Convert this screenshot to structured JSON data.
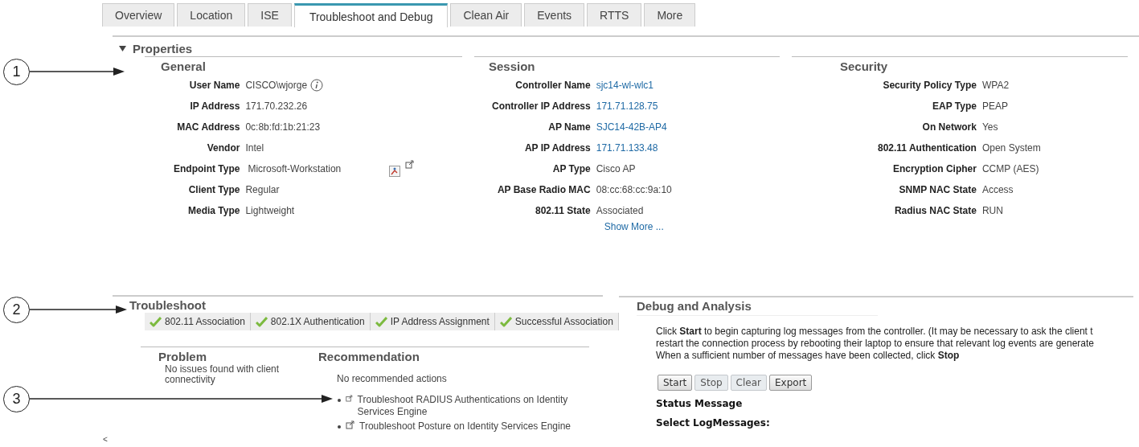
{
  "tabs": [
    {
      "label": "Overview",
      "selected": false
    },
    {
      "label": "Location",
      "selected": false
    },
    {
      "label": "ISE",
      "selected": false
    },
    {
      "label": "Troubleshoot and Debug",
      "selected": true
    },
    {
      "label": "Clean Air",
      "selected": false
    },
    {
      "label": "Events",
      "selected": false
    },
    {
      "label": "RTTS",
      "selected": false
    },
    {
      "label": "More",
      "selected": false
    }
  ],
  "properties": {
    "title": "Properties",
    "expanded": true,
    "groups": [
      {
        "title": "General",
        "fields": [
          {
            "label": "User Name",
            "value": "CISCO\\wjorge",
            "kind": "info"
          },
          {
            "label": "IP Address",
            "value": "171.70.232.26",
            "kind": "text"
          },
          {
            "label": "MAC Address",
            "value": "0c:8b:fd:1b:21:23",
            "kind": "text"
          },
          {
            "label": "Vendor",
            "value": "Intel",
            "kind": "text"
          },
          {
            "label": "Endpoint Type",
            "value": "Microsoft-Workstation",
            "kind": "tools"
          },
          {
            "label": "Client Type",
            "value": "Regular",
            "kind": "text"
          },
          {
            "label": "Media Type",
            "value": "Lightweight",
            "kind": "text"
          }
        ]
      },
      {
        "title": "Session",
        "more": "Show More ...",
        "fields": [
          {
            "label": "Controller Name",
            "value": "sjc14-wl-wlc1",
            "kind": "link"
          },
          {
            "label": "Controller IP Address",
            "value": "171.71.128.75",
            "kind": "link"
          },
          {
            "label": "AP Name",
            "value": "SJC14-42B-AP4",
            "kind": "link"
          },
          {
            "label": "AP IP Address",
            "value": "171.71.133.48",
            "kind": "link"
          },
          {
            "label": "AP Type",
            "value": "Cisco AP",
            "kind": "text"
          },
          {
            "label": "AP Base Radio MAC",
            "value": "08:cc:68:cc:9a:10",
            "kind": "text"
          },
          {
            "label": "802.11 State",
            "value": "Associated",
            "kind": "text"
          }
        ]
      },
      {
        "title": "Security",
        "fields": [
          {
            "label": "Security Policy Type",
            "value": "WPA2",
            "kind": "text"
          },
          {
            "label": "EAP Type",
            "value": "PEAP",
            "kind": "text"
          },
          {
            "label": "On Network",
            "value": "Yes",
            "kind": "text"
          },
          {
            "label": "802.11 Authentication",
            "value": "Open System",
            "kind": "text"
          },
          {
            "label": "Encryption Cipher",
            "value": "CCMP (AES)",
            "kind": "text"
          },
          {
            "label": "SNMP NAC State",
            "value": "Access",
            "kind": "text"
          },
          {
            "label": "Radius NAC State",
            "value": "RUN",
            "kind": "text"
          }
        ]
      }
    ]
  },
  "troubleshoot": {
    "title": "Troubleshoot",
    "steps": [
      {
        "label": "802.11 Association",
        "passed": true
      },
      {
        "label": "802.1X Authentication",
        "passed": true
      },
      {
        "label": "IP Address Assignment",
        "passed": true
      },
      {
        "label": "Successful Association",
        "passed": true
      }
    ],
    "problem": {
      "title": "Problem",
      "text": "No issues found with client connectivity"
    },
    "recommendation": {
      "title": "Recommendation",
      "text": "No recommended actions",
      "links": [
        "Troubleshoot RADIUS Authentications on Identity Services Engine",
        "Troubleshoot Posture on Identity Services Engine"
      ]
    }
  },
  "debug": {
    "title": "Debug and Analysis",
    "instructions": [
      "Click **Start** to begin capturing log messages from the controller. (It may be necessary to ask the client t",
      "restart the connection process by rebooting their laptop to ensure that relevant log events are generate",
      "When a sufficient number of messages have been collected, click **Stop**"
    ],
    "buttons": [
      {
        "label": "Start",
        "disabled": false
      },
      {
        "label": "Stop",
        "disabled": true
      },
      {
        "label": "Clear",
        "disabled": true
      },
      {
        "label": "Export",
        "disabled": false
      }
    ],
    "status_label": "Status Message",
    "select_label": "Select LogMessages:"
  },
  "callouts": [
    "1",
    "2",
    "3"
  ],
  "scroll_hint": "<"
}
